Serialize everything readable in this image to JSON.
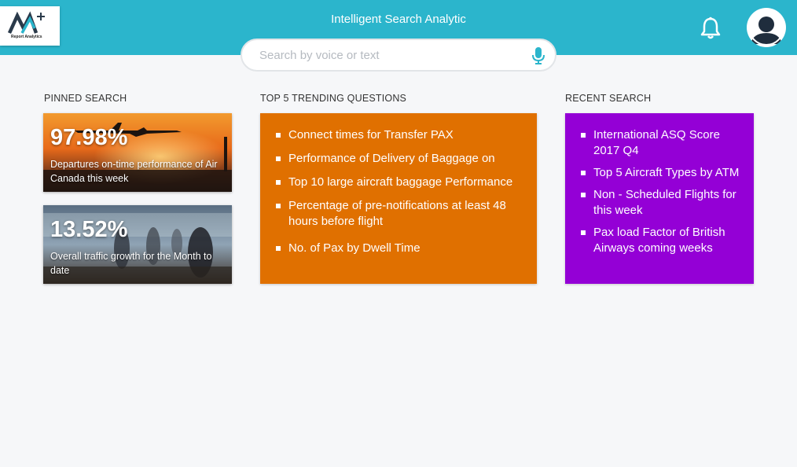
{
  "header": {
    "title": "Intelligent Search Analytic",
    "logo_text": "Report Analytics",
    "brand_color": "#2bb5cc"
  },
  "search": {
    "placeholder": "Search by voice or text",
    "value": ""
  },
  "icons": {
    "logo": "report-analytics-logo",
    "mic": "microphone-icon",
    "bell": "notification-bell-icon",
    "avatar": "user-avatar-icon"
  },
  "pinned": {
    "label": "PINNED SEARCH",
    "cards": [
      {
        "value": "97.98%",
        "description": "Departures on-time performance of Air Canada this week"
      },
      {
        "value": "13.52%",
        "description": "Overall traffic growth for the Month to date"
      }
    ]
  },
  "trending": {
    "label": "TOP 5 TRENDING QUESTIONS",
    "color": "#e07000",
    "items": [
      "Connect times for Transfer PAX",
      "Performance of Delivery of Baggage on",
      "Top 10 large aircraft baggage Performance",
      "Percentage of pre-notifications at least 48 hours before flight",
      "No. of Pax by Dwell Time"
    ]
  },
  "recent": {
    "label": "RECENT SEARCH",
    "color": "#9400d6",
    "items": [
      "International ASQ Score 2017 Q4",
      "Top 5 Aircraft Types by ATM",
      "Non - Scheduled Flights for this week",
      "Pax load Factor of British Airways coming weeks"
    ]
  }
}
